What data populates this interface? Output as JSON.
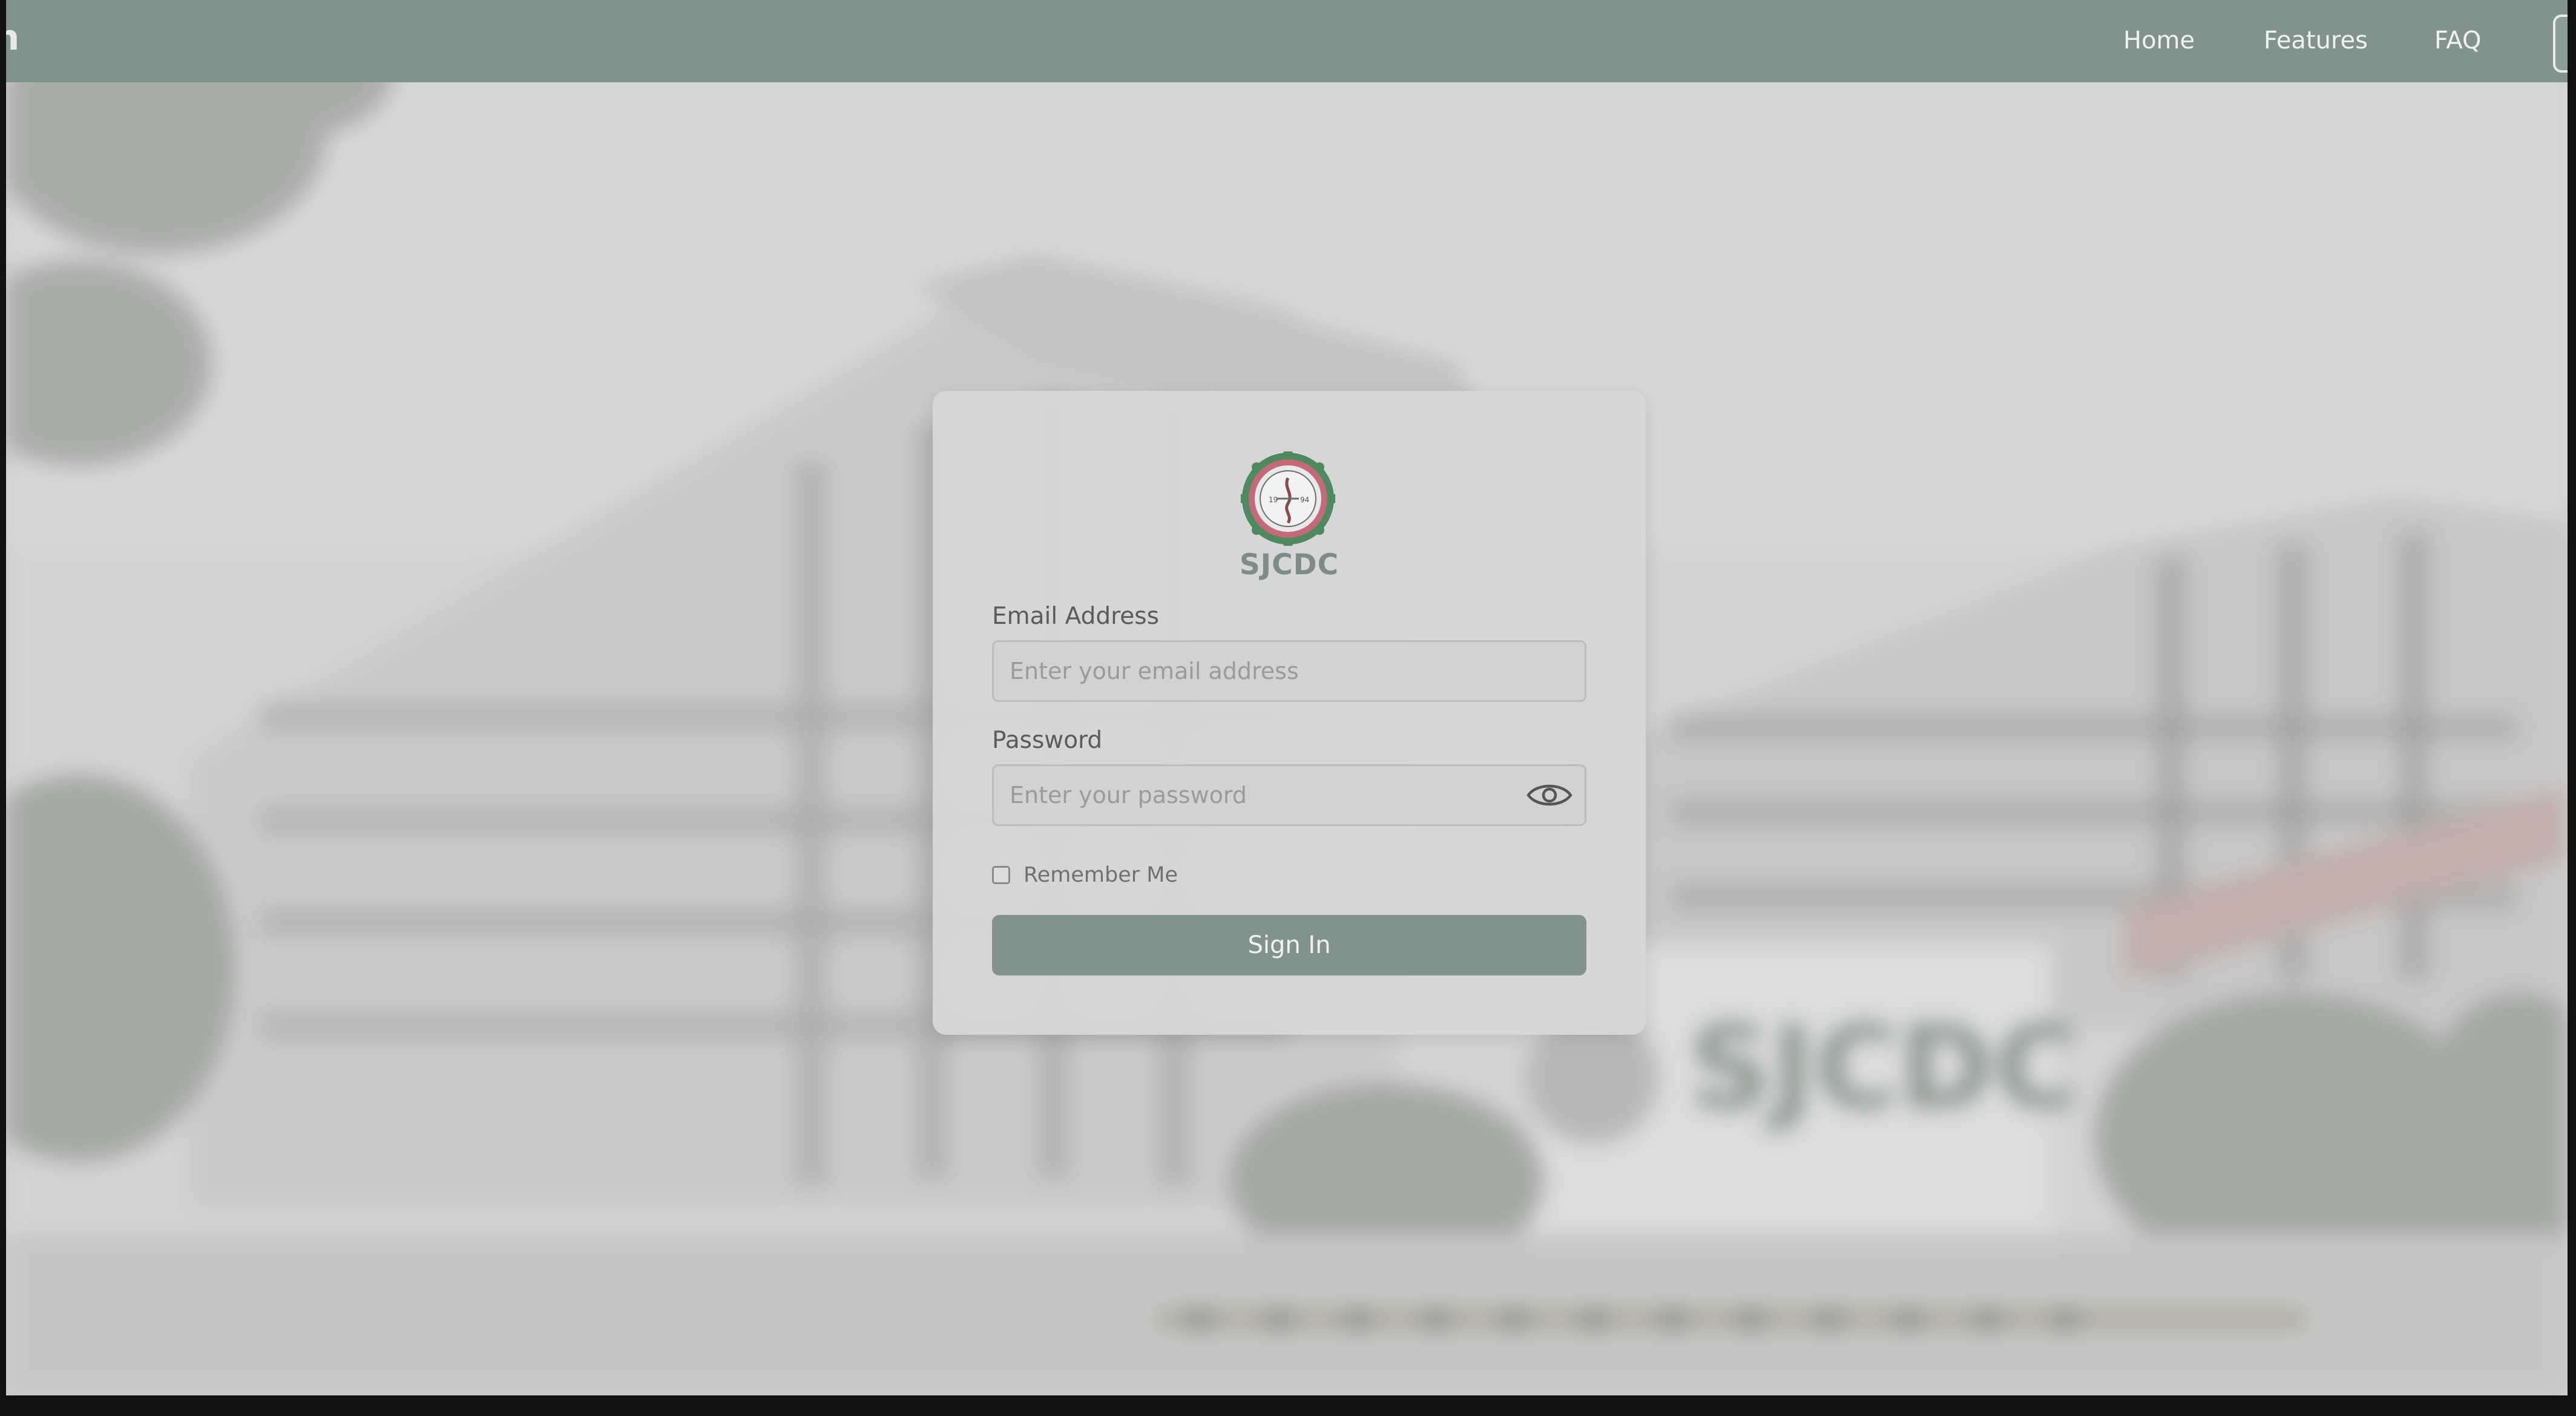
{
  "navbar": {
    "brand_fragment": "on",
    "links": [
      "Home",
      "Features",
      "FAQ"
    ]
  },
  "login": {
    "org_name": "SJCDC",
    "email": {
      "label": "Email Address",
      "placeholder": "Enter your email address",
      "value": ""
    },
    "password": {
      "label": "Password",
      "placeholder": "Enter your password",
      "value": ""
    },
    "remember_label": "Remember Me",
    "remember_checked": false,
    "submit_label": "Sign In"
  },
  "icons": {
    "password_toggle": "eye-icon",
    "logo": "sjcdc-seal-logo"
  },
  "background": {
    "sign_text": "SJCDC"
  },
  "colors": {
    "primary": "#82938d",
    "org_text": "#7c8c86",
    "card": "#d6d6d6",
    "nav_text": "#eef2f0"
  }
}
